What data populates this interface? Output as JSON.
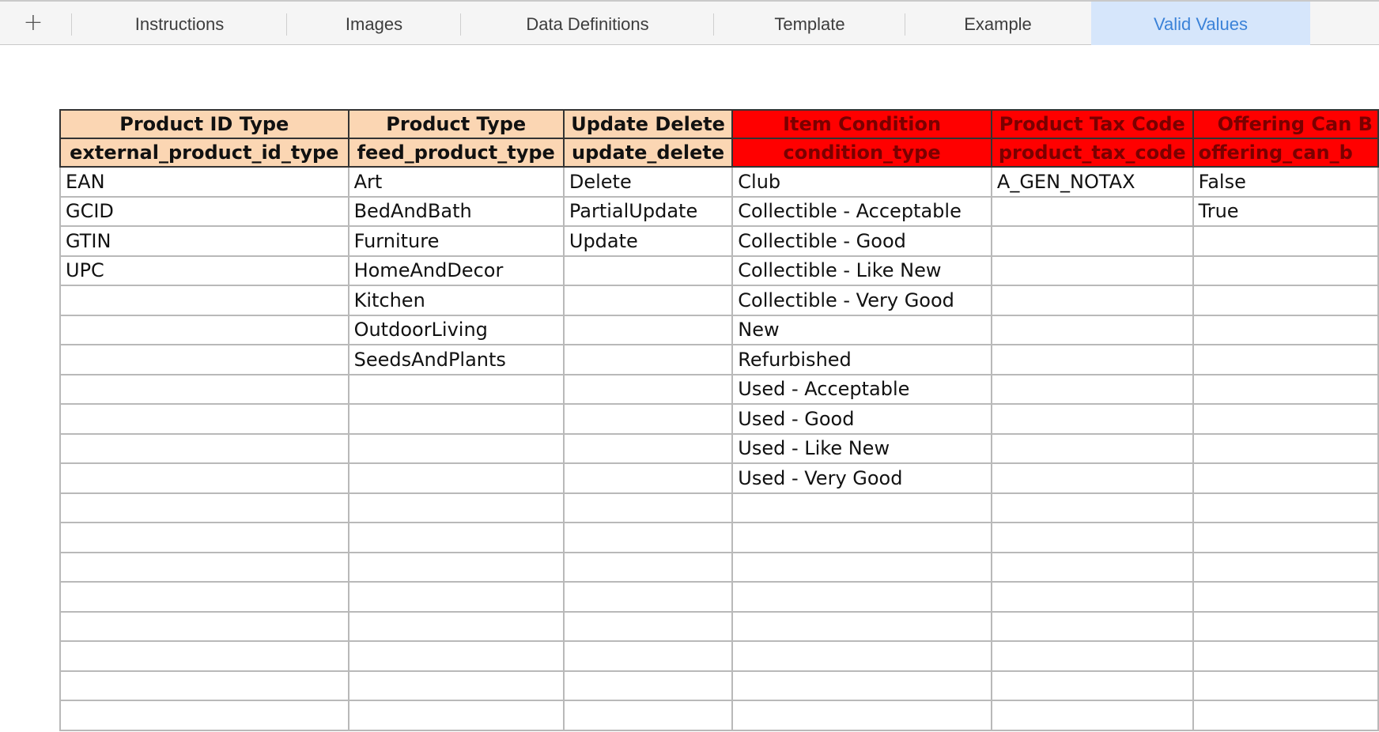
{
  "tabs": {
    "add_label": "+",
    "items": [
      {
        "label": "Instructions",
        "active": false
      },
      {
        "label": "Images",
        "active": false
      },
      {
        "label": "Data Definitions",
        "active": false
      },
      {
        "label": "Template",
        "active": false
      },
      {
        "label": "Example",
        "active": false
      },
      {
        "label": "Valid Values",
        "active": true
      }
    ]
  },
  "colors": {
    "header_peach": "#fbd6b3",
    "header_red": "#ff0000",
    "active_tab_bg": "#d6e6fb",
    "active_tab_text": "#3b82d8"
  },
  "sheet": {
    "columns": [
      {
        "title": "Product ID Type",
        "field": "external_product_id_type",
        "style": "peach"
      },
      {
        "title": "Product Type",
        "field": "feed_product_type",
        "style": "peach"
      },
      {
        "title": "Update Delete",
        "field": "update_delete",
        "style": "peach"
      },
      {
        "title": "Item Condition",
        "field": "condition_type",
        "style": "red"
      },
      {
        "title": "Product Tax Code",
        "field": "product_tax_code",
        "style": "red"
      },
      {
        "title": "Offering Can B",
        "field": "offering_can_b",
        "style": "red"
      }
    ],
    "rows": [
      [
        "EAN",
        "Art",
        "Delete",
        "Club",
        "A_GEN_NOTAX",
        "False"
      ],
      [
        "GCID",
        "BedAndBath",
        "PartialUpdate",
        "Collectible - Acceptable",
        "",
        "True"
      ],
      [
        "GTIN",
        "Furniture",
        "Update",
        "Collectible - Good",
        "",
        ""
      ],
      [
        "UPC",
        "HomeAndDecor",
        "",
        "Collectible - Like New",
        "",
        ""
      ],
      [
        "",
        "Kitchen",
        "",
        "Collectible - Very Good",
        "",
        ""
      ],
      [
        "",
        "OutdoorLiving",
        "",
        "New",
        "",
        ""
      ],
      [
        "",
        "SeedsAndPlants",
        "",
        "Refurbished",
        "",
        ""
      ],
      [
        "",
        "",
        "",
        "Used - Acceptable",
        "",
        ""
      ],
      [
        "",
        "",
        "",
        "Used - Good",
        "",
        ""
      ],
      [
        "",
        "",
        "",
        "Used - Like New",
        "",
        ""
      ],
      [
        "",
        "",
        "",
        "Used - Very Good",
        "",
        ""
      ],
      [
        "",
        "",
        "",
        "",
        "",
        ""
      ],
      [
        "",
        "",
        "",
        "",
        "",
        ""
      ],
      [
        "",
        "",
        "",
        "",
        "",
        ""
      ],
      [
        "",
        "",
        "",
        "",
        "",
        ""
      ],
      [
        "",
        "",
        "",
        "",
        "",
        ""
      ],
      [
        "",
        "",
        "",
        "",
        "",
        ""
      ],
      [
        "",
        "",
        "",
        "",
        "",
        ""
      ],
      [
        "",
        "",
        "",
        "",
        "",
        ""
      ]
    ]
  }
}
